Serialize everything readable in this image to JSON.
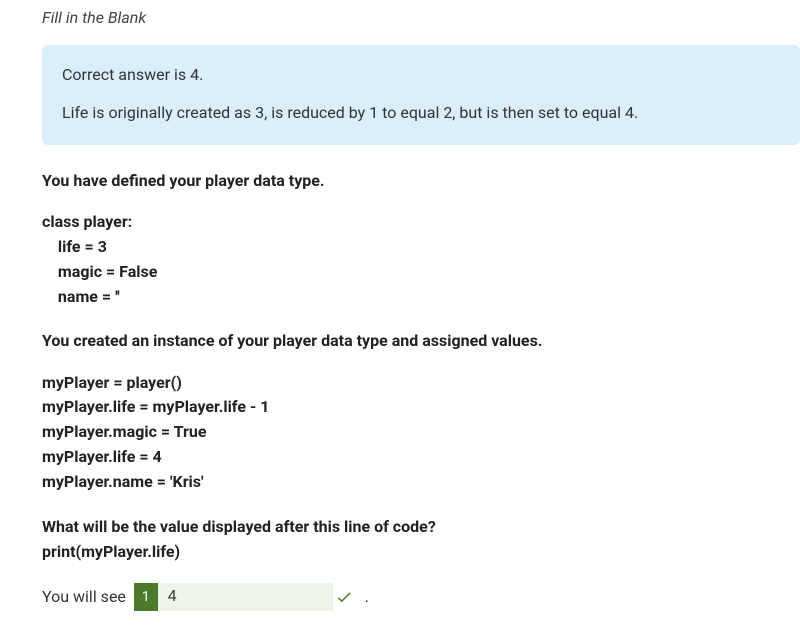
{
  "questionType": "Fill in the Blank",
  "feedback": {
    "line1": "Correct answer is 4.",
    "line2": "Life is originally created as 3, is reduced by 1 to equal 2, but is then set to equal 4."
  },
  "body": {
    "intro1": "You have defined your player data type.",
    "code1": "class player:\n    life = 3\n    magic = False\n    name = ''",
    "intro2": "You created an instance of your player data type and assigned values.",
    "code2": "myPlayer = player()\nmyPlayer.life = myPlayer.life - 1\nmyPlayer.magic = True\nmyPlayer.life = 4\nmyPlayer.name = 'Kris'",
    "question": "What will be the value displayed after this line of code?",
    "code3": "print(myPlayer.life)"
  },
  "answer": {
    "prefix": "You will see",
    "blankNumber": "1",
    "blankValue": "4",
    "suffix": "."
  }
}
